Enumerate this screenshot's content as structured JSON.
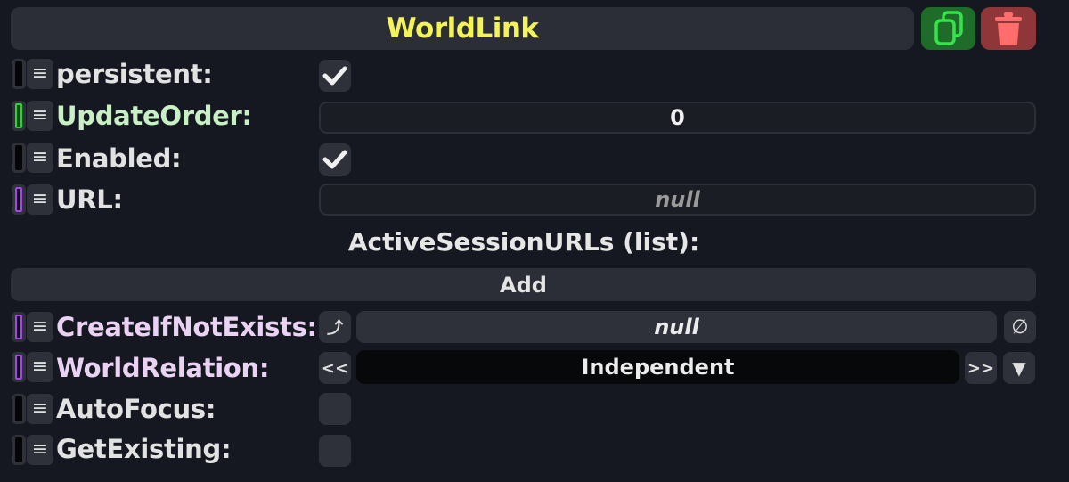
{
  "component": {
    "title": "WorldLink",
    "title_color": "#f3f35a",
    "duplicate_icon": "duplicate-icon",
    "delete_icon": "trash-icon"
  },
  "fields": {
    "persistent": {
      "label": "persistent:",
      "checked": true
    },
    "update_order": {
      "label": "UpdateOrder:",
      "value": "0"
    },
    "enabled": {
      "label": "Enabled:",
      "checked": true
    },
    "url": {
      "label": "URL:",
      "value": "null"
    }
  },
  "list": {
    "title": "ActiveSessionURLs (list):",
    "add_label": "Add"
  },
  "fields2": {
    "create_if_not_exists": {
      "label": "CreateIfNotExists:",
      "value": "null",
      "set_icon": "⤴",
      "clear_icon": "∅"
    },
    "world_relation": {
      "label": "WorldRelation:",
      "value": "Independent",
      "prev": "<<",
      "next": ">>",
      "dropdown": "▼"
    },
    "auto_focus": {
      "label": "AutoFocus:",
      "checked": false
    },
    "get_existing": {
      "label": "GetExisting:",
      "checked": false
    }
  },
  "colors": {
    "background": "#151820",
    "duplicate_button": "#1e6b2a",
    "delete_button": "#8f3638",
    "green_connector": "#27d53a",
    "purple_connector": "#a04be0"
  }
}
